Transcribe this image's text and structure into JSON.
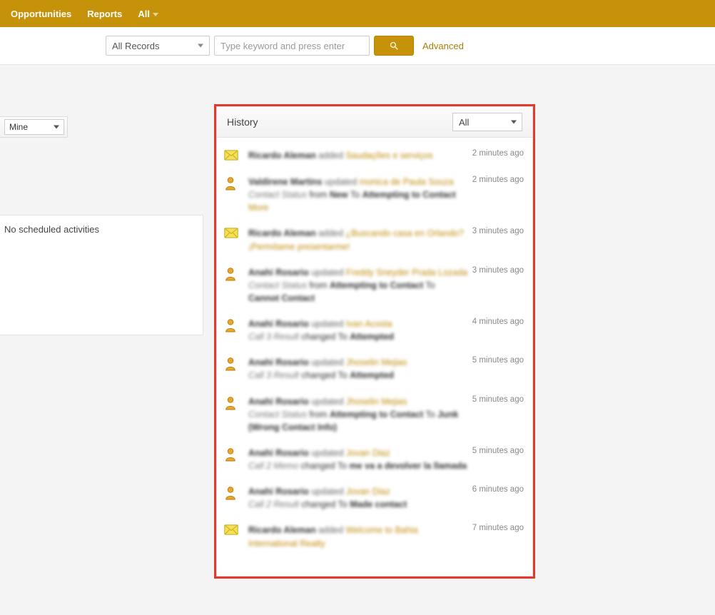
{
  "nav": {
    "items": [
      "Opportunities",
      "Reports",
      "All"
    ]
  },
  "search": {
    "records_filter": "All Records",
    "placeholder": "Type keyword and press enter",
    "advanced": "Advanced"
  },
  "left": {
    "mine_select": "Mine",
    "no_activities": "No scheduled activities"
  },
  "history": {
    "title": "History",
    "filter": "All",
    "items": [
      {
        "icon": "mail",
        "time": "2 minutes ago",
        "actor": "Ricardo Aleman",
        "action": "added",
        "link": "Saudações e serviços",
        "extra": ""
      },
      {
        "icon": "person",
        "time": "2 minutes ago",
        "actor": "Valdirene Martins",
        "action": "updated",
        "link": "monica de Paula Souza",
        "extra": "<span class='field'>Contact Status</span> from <span class='val'>New</span> To <span class='val'>Attempting to Contact</span><br><span class='link'>More</span>"
      },
      {
        "icon": "mail",
        "time": "3 minutes ago",
        "actor": "Ricardo Aleman",
        "action": "added",
        "link": "¿Buscando casa en Orlando? ¡Permítame presentarme!",
        "extra": ""
      },
      {
        "icon": "person",
        "time": "3 minutes ago",
        "actor": "Anahi Rosario",
        "action": "updated",
        "link": "Freddy Sneyder Prada Lozada",
        "extra": "<span class='field'>Contact Status</span> from <span class='val'>Attempting to Contact</span> To <span class='val'>Cannot Contact</span>"
      },
      {
        "icon": "person",
        "time": "4 minutes ago",
        "actor": "Anahi Rosario",
        "action": "updated",
        "link": "Ivan Acosta",
        "extra": "<span class='field'>Call 3 Result</span> changed To <span class='val'>Attempted</span>"
      },
      {
        "icon": "person",
        "time": "5 minutes ago",
        "actor": "Anahi Rosario",
        "action": "updated",
        "link": "Jhoselin Mejias",
        "extra": "<span class='field'>Call 3 Result</span> changed To <span class='val'>Attempted</span>"
      },
      {
        "icon": "person",
        "time": "5 minutes ago",
        "actor": "Anahi Rosario",
        "action": "updated",
        "link": "Jhoselin Mejias",
        "extra": "<span class='field'>Contact Status</span> from <span class='val'>Attempting to Contact</span> To <span class='val'>Junk (Wrong Contact Info)</span>"
      },
      {
        "icon": "person",
        "time": "5 minutes ago",
        "actor": "Anahi Rosario",
        "action": "updated",
        "link": "Jovan Diaz",
        "extra": "<span class='field'>Call 2 Memo</span> changed To <span class='val'>me va a devolver la llamada</span>"
      },
      {
        "icon": "person",
        "time": "6 minutes ago",
        "actor": "Anahi Rosario",
        "action": "updated",
        "link": "Jovan Diaz",
        "extra": "<span class='field'>Call 2 Result</span> changed To <span class='val'>Made contact</span>"
      },
      {
        "icon": "mail",
        "time": "7 minutes ago",
        "actor": "Ricardo Aleman",
        "action": "added",
        "link": "Welcome to Bahia International Realty",
        "extra": ""
      }
    ]
  }
}
